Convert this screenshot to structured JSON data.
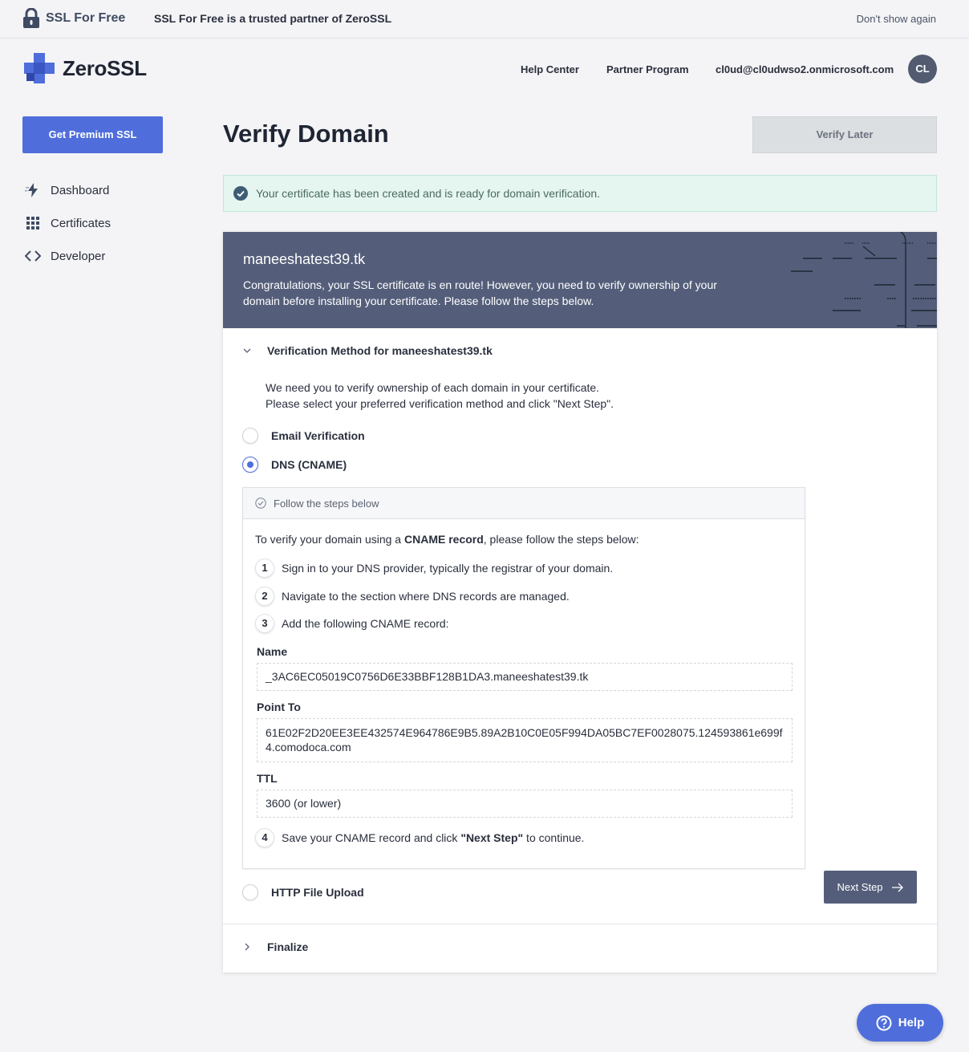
{
  "promo_bar": {
    "brand": "SSL For Free",
    "partner_text": "SSL For Free is a trusted partner of ZeroSSL",
    "dismiss": "Don't show again"
  },
  "header": {
    "logo_text": "ZeroSSL",
    "nav": [
      "Help Center",
      "Partner Program"
    ],
    "user_email": "cl0ud@cl0udwso2.onmicrosoft.com",
    "avatar_initials": "CL"
  },
  "sidebar": {
    "cta": "Get Premium SSL",
    "items": [
      {
        "label": "Dashboard",
        "icon": "bolt-icon"
      },
      {
        "label": "Certificates",
        "icon": "grid-icon"
      },
      {
        "label": "Developer",
        "icon": "code-icon"
      }
    ]
  },
  "main": {
    "title": "Verify Domain",
    "verify_later": "Verify Later",
    "alert": "Your certificate has been created and is ready for domain verification.",
    "card": {
      "domain": "maneeshatest39.tk",
      "congrats": "Congratulations, your SSL certificate is en route! However, you need to verify ownership of your domain before installing your certificate. Please follow the steps below.",
      "section_title": "Verification Method for maneeshatest39.tk",
      "intro_line1": "We need you to verify ownership of each domain in your certificate.",
      "intro_line2": "Please select your preferred verification method and click \"Next Step\".",
      "methods": [
        {
          "label": "Email Verification",
          "selected": false
        },
        {
          "label": "DNS (CNAME)",
          "selected": true
        },
        {
          "label": "HTTP File Upload",
          "selected": false
        }
      ],
      "steps_header": "Follow the steps below",
      "steps_intro_pre": "To verify your domain using a ",
      "steps_intro_bold": "CNAME record",
      "steps_intro_post": ", please follow the steps below:",
      "steps": [
        {
          "num": "1",
          "text": "Sign in to your DNS provider, typically the registrar of your domain."
        },
        {
          "num": "2",
          "text": "Navigate to the section where DNS records are managed."
        },
        {
          "num": "3",
          "text": "Add the following CNAME record:"
        }
      ],
      "step4": {
        "num": "4",
        "pre": "Save your CNAME record and click ",
        "bold": "\"Next Step\"",
        "post": " to continue."
      },
      "fields": {
        "name_label": "Name",
        "name_value": "_3AC6EC05019C0756D6E33BBF128B1DA3.maneeshatest39.tk",
        "point_label": "Point To",
        "point_value": "61E02F2D20EE3EE432574E964786E9B5.89A2B10C0E05F994DA05BC7EF0028075.124593861e699f4.comodoca.com",
        "ttl_label": "TTL",
        "ttl_value": "3600 (or lower)"
      },
      "next_step": "Next Step",
      "finalize": "Finalize"
    }
  },
  "help_button": "Help",
  "colors": {
    "accent": "#4f6edb",
    "header_slate": "#545e7a",
    "success_bg": "#e5f5ef",
    "success_icon": "#3e5c74"
  }
}
